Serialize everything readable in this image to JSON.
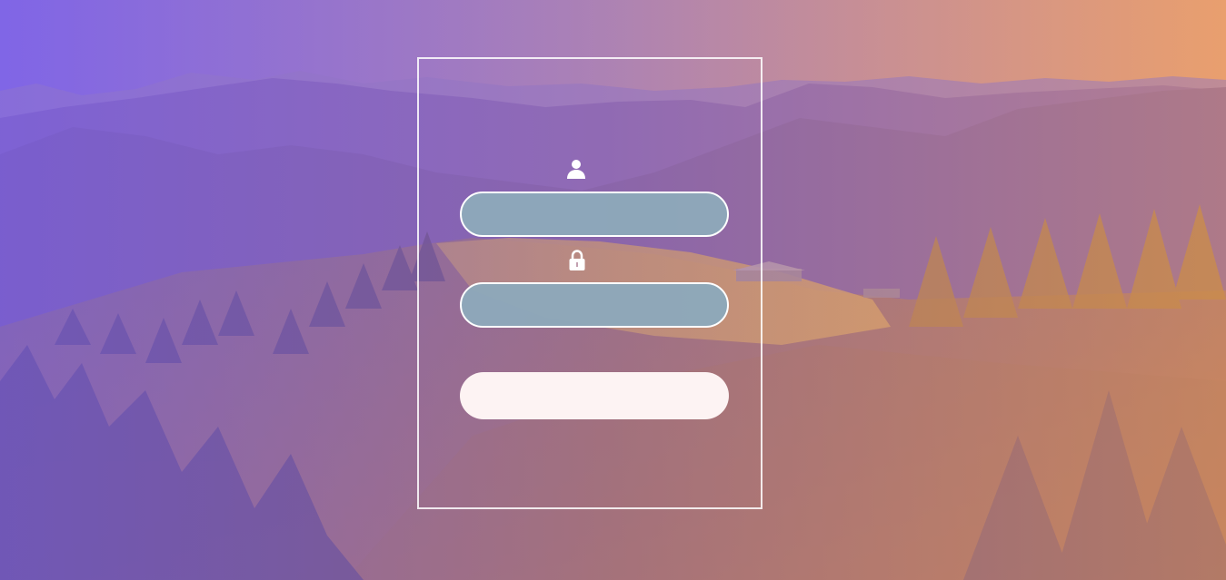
{
  "background": {
    "image": "mountain-landscape",
    "overlay_colors": [
      "#785eeb",
      "#ec9b5f"
    ]
  },
  "login": {
    "username": {
      "icon": "user-icon",
      "value": "",
      "placeholder": ""
    },
    "password": {
      "icon": "lock-icon",
      "value": "",
      "placeholder": ""
    },
    "submit_label": ""
  },
  "colors": {
    "field_fill": "#8da8ba",
    "button_fill": "#fdf3f3",
    "frame_border": "#ffffff"
  }
}
